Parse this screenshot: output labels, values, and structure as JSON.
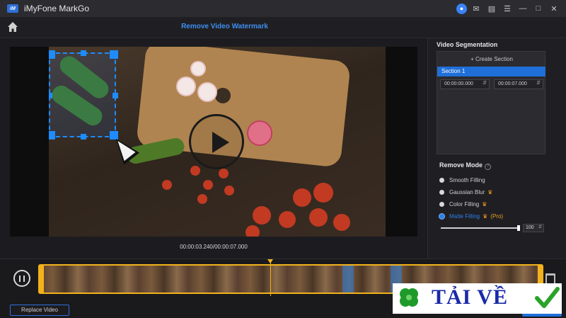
{
  "app": {
    "title": "iMyFone MarkGo",
    "logo_text": "iM"
  },
  "window_icons": [
    "user-icon",
    "mail-icon",
    "feedback-icon",
    "menu-icon",
    "minimize-icon",
    "maximize-icon",
    "close-icon"
  ],
  "header": {
    "page_title": "Remove Video Watermark",
    "home_icon": "home-icon"
  },
  "player": {
    "timecode": "00:00:03.240/00:00:07.000"
  },
  "segmentation": {
    "title": "Video Segmentation",
    "create_label": "+ Create Section",
    "section_label": "Section 1",
    "start_time": "00:00:00.000",
    "end_time": "00:00:07.000"
  },
  "remove_mode": {
    "title": "Remove Mode",
    "options": [
      {
        "label": "Smooth Filling",
        "crown": false,
        "selected": false
      },
      {
        "label": "Gaussian Blur",
        "crown": true,
        "selected": false
      },
      {
        "label": "Color Filling",
        "crown": true,
        "selected": false
      },
      {
        "label": "Matte Filling",
        "crown": true,
        "pro": "(Pro)",
        "selected": true
      }
    ],
    "strength": "100"
  },
  "footer": {
    "replace_label": "Replace Video"
  },
  "overlay": {
    "banner_text": "TẢI VỀ"
  },
  "colors": {
    "accent": "#1f6fd8",
    "title_blue": "#3f8ff0",
    "timeline_gold": "#f2b21b",
    "crown": "#f0a020"
  }
}
